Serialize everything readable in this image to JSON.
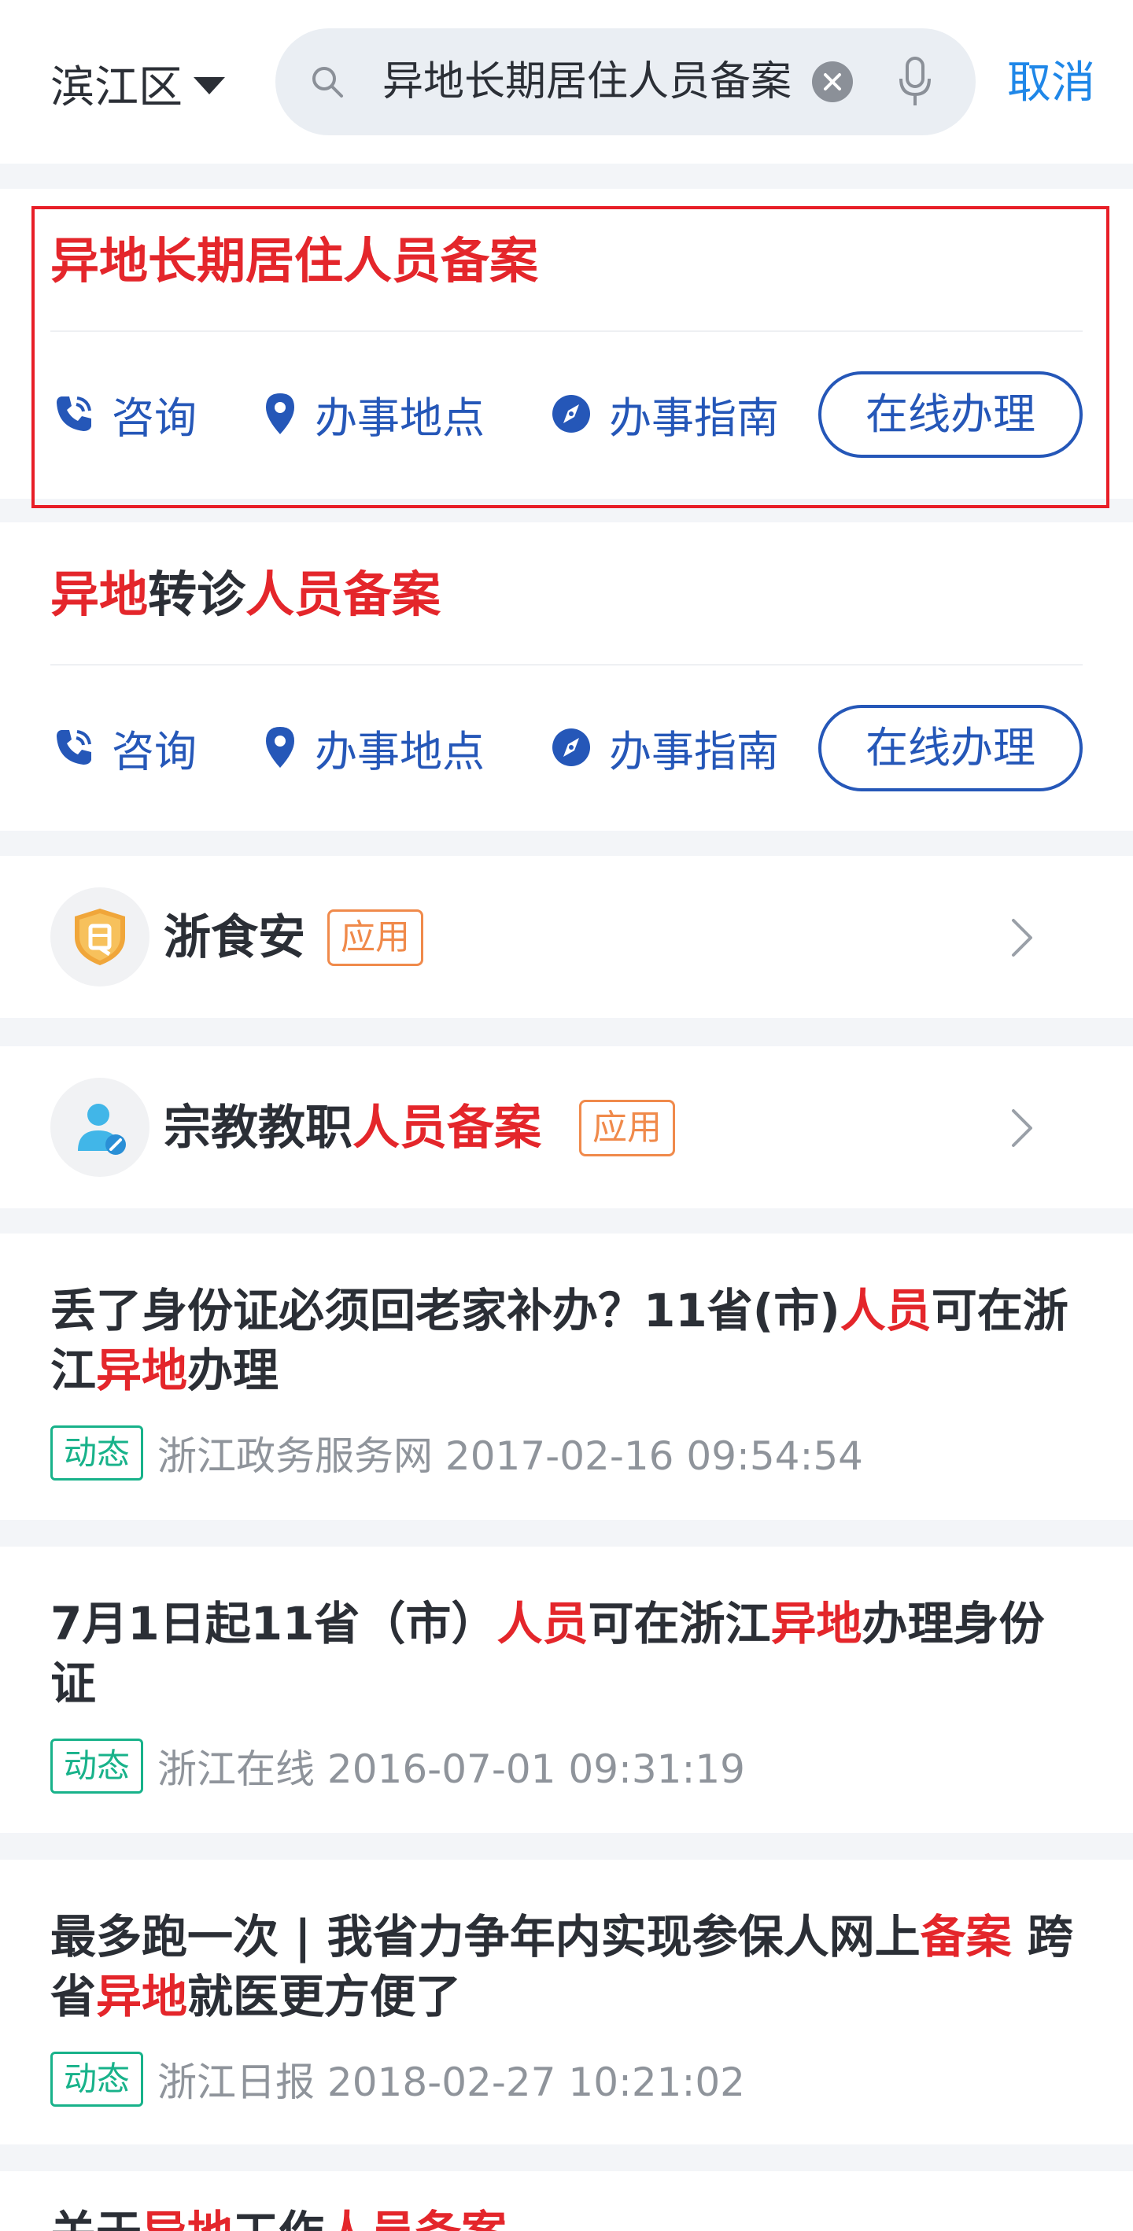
{
  "header": {
    "district": "滨江区",
    "search_query": "异地长期居住人员备案",
    "cancel_label": "取消"
  },
  "service_cards": [
    {
      "title_parts": [
        "异地长期居住人员备案"
      ],
      "actions": {
        "consult": "咨询",
        "location": "办事地点",
        "guide": "办事指南",
        "online": "在线办理"
      }
    },
    {
      "title_parts": [
        "异地",
        "转诊",
        "人员备案"
      ],
      "actions": {
        "consult": "咨询",
        "location": "办事地点",
        "guide": "办事指南",
        "online": "在线办理"
      }
    }
  ],
  "apps": [
    {
      "name": "浙食安",
      "badge": "应用",
      "icon": "food-safety-shield-icon"
    },
    {
      "name_parts": [
        "宗教教职",
        "人员备案"
      ],
      "badge": "应用",
      "icon": "person-edit-icon"
    }
  ],
  "news": [
    {
      "title_parts": [
        "丢了身份证必须回老家补办？11省(市)",
        "人员",
        "可在浙江",
        "异地",
        "办理"
      ],
      "tag": "动态",
      "source": "浙江政务服务网 2017-02-16 09:54:54"
    },
    {
      "title_parts": [
        "7月1日起11省（市）",
        "人员",
        "可在浙江",
        "异地",
        "办理身份证"
      ],
      "tag": "动态",
      "source": "浙江在线 2016-07-01 09:31:19"
    },
    {
      "title_parts": [
        "最多跑一次 | 我省力争年内实现参保人网上",
        "备案",
        " 跨省",
        "异地",
        "就医更方便了"
      ],
      "tag": "动态",
      "source": "浙江日报 2018-02-27 10:21:02"
    },
    {
      "title_parts": [
        "关于",
        "异地",
        "工作",
        "人员备案"
      ]
    }
  ],
  "colors": {
    "highlight": "#e4262b",
    "link": "#2557b8",
    "accent": "#1f87e8",
    "badge": "#f08a4b",
    "tag": "#18b28a"
  }
}
